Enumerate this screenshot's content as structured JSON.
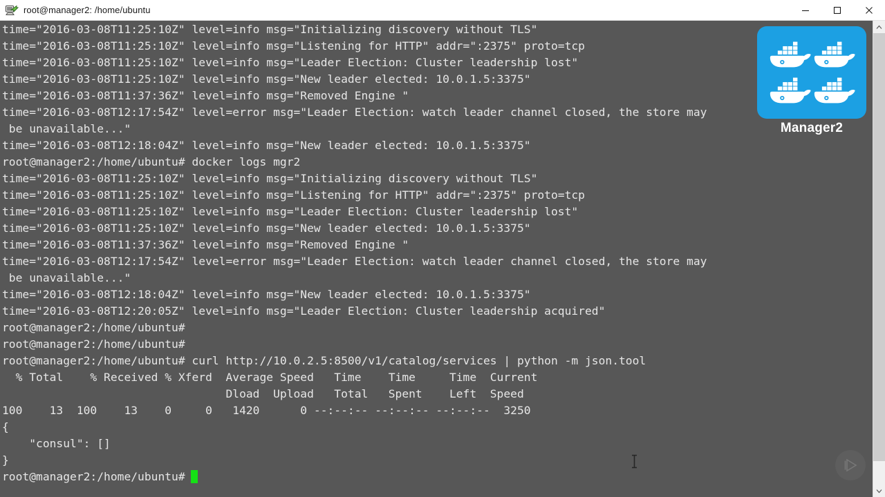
{
  "window": {
    "title": "root@manager2: /home/ubuntu",
    "app_icon": "putty-icon",
    "controls": {
      "minimize_label": "Minimize",
      "maximize_label": "Maximize",
      "close_label": "Close"
    }
  },
  "overlay": {
    "badge_label": "Manager2",
    "badge_icon": "docker-whale-grid-icon",
    "badge_color": "#1ca0e3",
    "watermark_icon": "play-button-icon"
  },
  "scrollbar": {
    "up_icon": "chevron-up-icon",
    "down_icon": "chevron-down-icon"
  },
  "terminal": {
    "prompt": "root@manager2:/home/ubuntu#",
    "cursor_color": "#15e016",
    "background_color": "#575757",
    "foreground_color": "#e6e6e6",
    "lines": [
      "time=\"2016-03-08T11:25:10Z\" level=info msg=\"Initializing discovery without TLS\"",
      "time=\"2016-03-08T11:25:10Z\" level=info msg=\"Listening for HTTP\" addr=\":2375\" proto=tcp",
      "time=\"2016-03-08T11:25:10Z\" level=info msg=\"Leader Election: Cluster leadership lost\"",
      "time=\"2016-03-08T11:25:10Z\" level=info msg=\"New leader elected: 10.0.1.5:3375\"",
      "time=\"2016-03-08T11:37:36Z\" level=info msg=\"Removed Engine \"",
      "time=\"2016-03-08T12:17:54Z\" level=error msg=\"Leader Election: watch leader channel closed, the store may",
      " be unavailable...\"",
      "time=\"2016-03-08T12:18:04Z\" level=info msg=\"New leader elected: 10.0.1.5:3375\"",
      "root@manager2:/home/ubuntu# docker logs mgr2",
      "time=\"2016-03-08T11:25:10Z\" level=info msg=\"Initializing discovery without TLS\"",
      "time=\"2016-03-08T11:25:10Z\" level=info msg=\"Listening for HTTP\" addr=\":2375\" proto=tcp",
      "time=\"2016-03-08T11:25:10Z\" level=info msg=\"Leader Election: Cluster leadership lost\"",
      "time=\"2016-03-08T11:25:10Z\" level=info msg=\"New leader elected: 10.0.1.5:3375\"",
      "time=\"2016-03-08T11:37:36Z\" level=info msg=\"Removed Engine \"",
      "time=\"2016-03-08T12:17:54Z\" level=error msg=\"Leader Election: watch leader channel closed, the store may",
      " be unavailable...\"",
      "time=\"2016-03-08T12:18:04Z\" level=info msg=\"New leader elected: 10.0.1.5:3375\"",
      "time=\"2016-03-08T12:20:05Z\" level=info msg=\"Leader Election: Cluster leadership acquired\"",
      "root@manager2:/home/ubuntu#",
      "root@manager2:/home/ubuntu#",
      "root@manager2:/home/ubuntu# curl http://10.0.2.5:8500/v1/catalog/services | python -m json.tool",
      "  % Total    % Received % Xferd  Average Speed   Time    Time     Time  Current",
      "                                 Dload  Upload   Total   Spent    Left  Speed",
      "100    13  100    13    0     0   1420      0 --:--:-- --:--:-- --:--:--  3250",
      "{",
      "    \"consul\": []",
      "}"
    ],
    "last_prompt": "root@manager2:/home/ubuntu#"
  }
}
